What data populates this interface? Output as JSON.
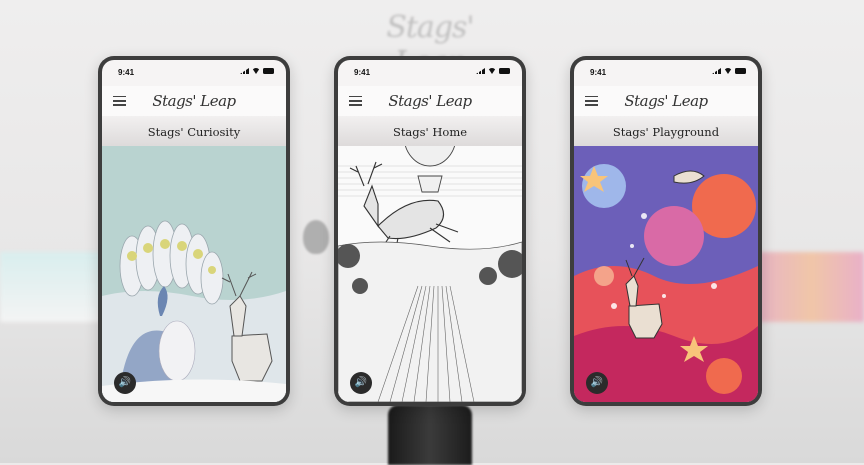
{
  "background": {
    "logo_text": "Stags' Leap"
  },
  "phones": [
    {
      "status_time": "9:41",
      "logo": "Stags' Leap",
      "title": "Stags' Curiosity",
      "scene": "curiosity",
      "accent": "#b9d3d0"
    },
    {
      "status_time": "9:41",
      "logo": "Stags' Leap",
      "title": "Stags' Home",
      "scene": "home",
      "accent": "#ffffff"
    },
    {
      "status_time": "9:41",
      "logo": "Stags' Leap",
      "title": "Stags' Playground",
      "scene": "playground",
      "accent": "#f06a4e"
    }
  ],
  "icons": {
    "menu": "hamburger-menu-icon",
    "sound": "speaker-icon",
    "signal": "cellular-signal-icon",
    "wifi": "wifi-icon",
    "battery": "battery-icon"
  }
}
